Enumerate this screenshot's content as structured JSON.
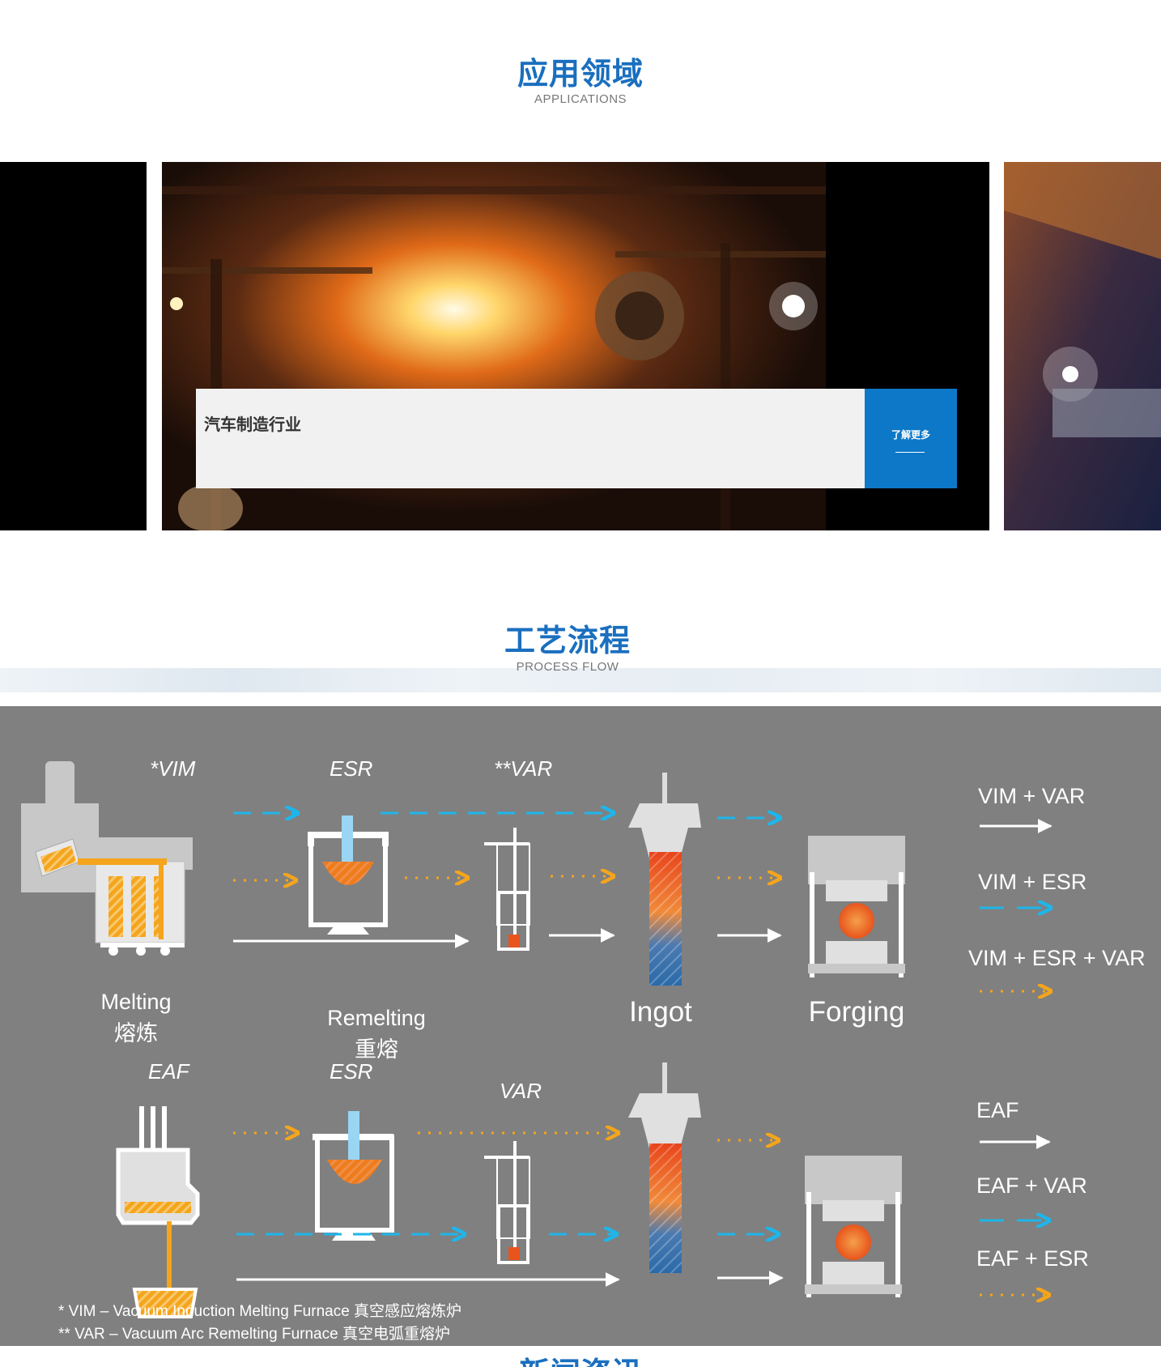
{
  "applications": {
    "title": "应用领域",
    "subtitle": "APPLICATIONS",
    "slide": {
      "caption": "汽车制造行业",
      "more_label": "了解更多"
    }
  },
  "process": {
    "title": "工艺流程",
    "subtitle": "PROCESS FLOW",
    "top": {
      "vim": "*VIM",
      "esr": "ESR",
      "var": "**VAR",
      "melting_en": "Melting",
      "melting_zh": "熔炼",
      "remelting_en": "Remelting",
      "remelting_zh": "重熔",
      "ingot": "Ingot",
      "forging": "Forging",
      "legend": [
        "VIM + VAR",
        "VIM + ESR",
        "VIM + ESR + VAR"
      ]
    },
    "bottom": {
      "eaf": "EAF",
      "esr": "ESR",
      "var": "VAR",
      "legend": [
        "EAF",
        "EAF + VAR",
        "EAF + ESR"
      ]
    },
    "notes": [
      "*  VIM – Vacuum Induction Melting Furnace 真空感应熔炼炉",
      "** VAR – Vacuum Arc Remelting Furnace 真空电弧重熔炉"
    ],
    "colors": {
      "cyan": "#1eb6ea",
      "orange": "#f4a51c",
      "white": "#ffffff",
      "gray": "#808080"
    }
  },
  "next_section": {
    "title": "新闻资讯"
  }
}
